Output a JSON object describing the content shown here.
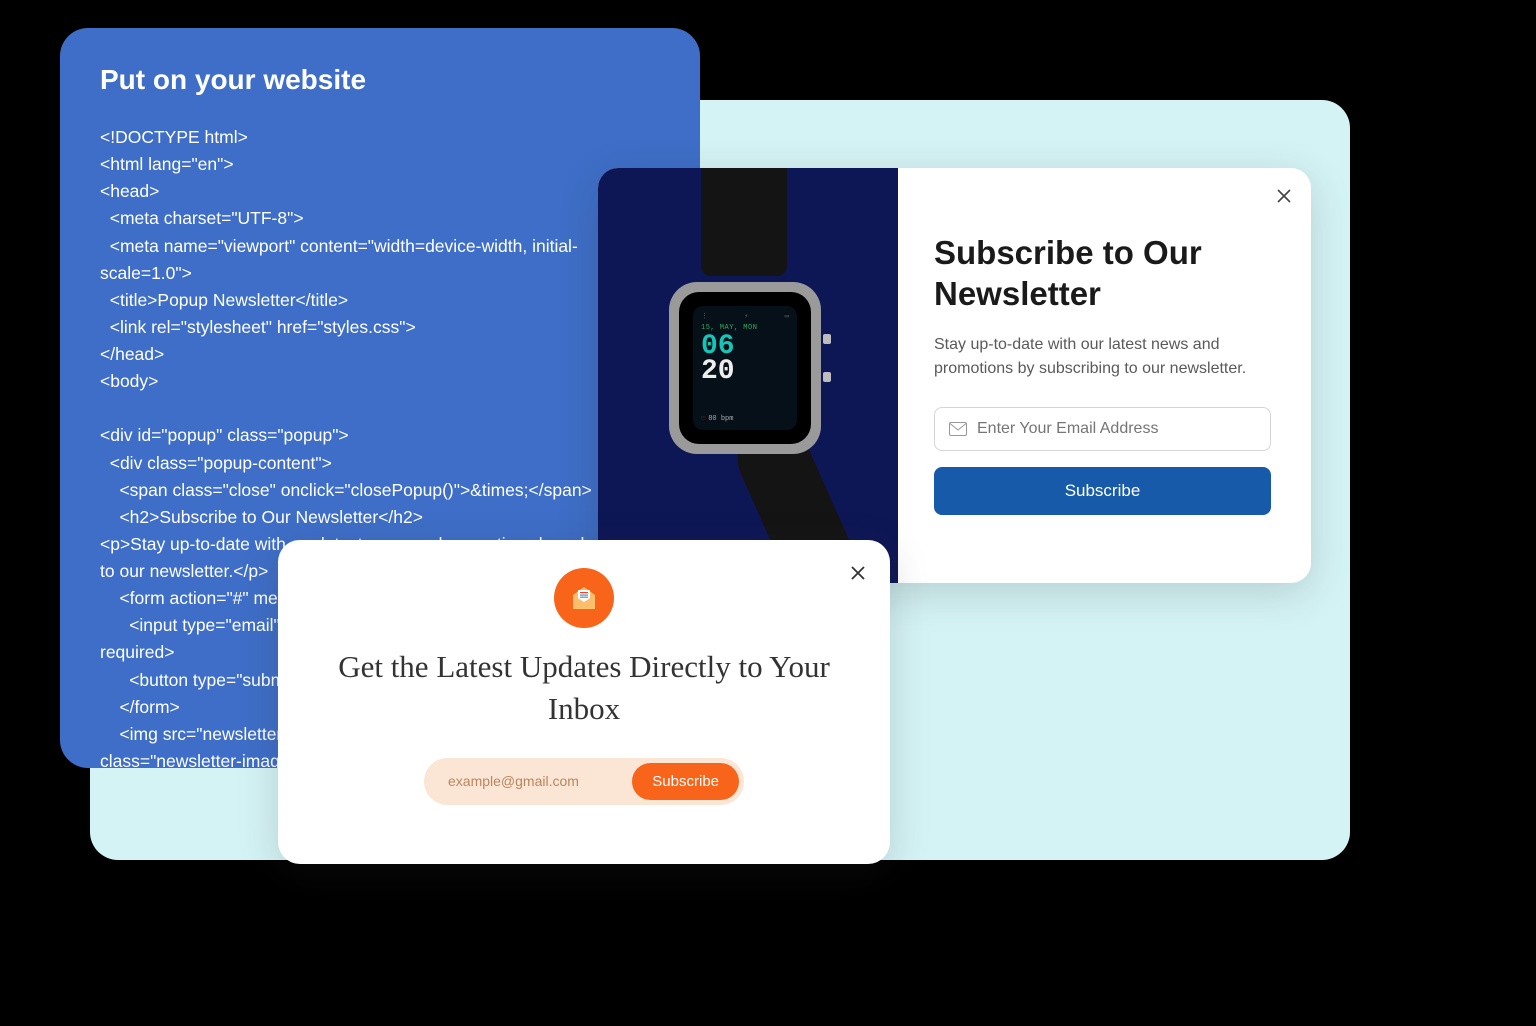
{
  "code_card": {
    "title": "Put on your website",
    "code": "<!DOCTYPE html>\n<html lang=\"en\">\n<head>\n  <meta charset=\"UTF-8\">\n  <meta name=\"viewport\" content=\"width=device-width, initial-scale=1.0\">\n  <title>Popup Newsletter</title>\n  <link rel=\"stylesheet\" href=\"styles.css\">\n</head>\n<body>\n\n<div id=\"popup\" class=\"popup\">\n  <div class=\"popup-content\">\n    <span class=\"close\" onclick=\"closePopup()\">&times;</span>\n    <h2>Subscribe to Our Newsletter</h2>\n<p>Stay up-to-date with our latest news and promotions by subscribing to our newsletter.</p>\n    <form action=\"#\" method=\"post\" id=\"subscribe-form\">\n      <input type=\"email\" name=\"email\" placeholder=\"Enter your email\" required>\n      <button type=\"submit\">Subscribe</button>\n    </form>\n    <img src=\"newsletter-image.jpg\" alt=\"Newsletter Image\" class=\"newsletter-image\">\n  </div>\n</div>\n\n<script src=\"script.js\"></script>\n</body>\n</html>"
  },
  "popup1": {
    "heading": "Subscribe to Our Newsletter",
    "body": "Stay up-to-date with our latest news and promotions by subscribing to our newsletter.",
    "email_placeholder": "Enter Your Email Address",
    "subscribe_label": "Subscribe",
    "watch": {
      "date": "15, MAY, MON",
      "hour": "06",
      "minute": "20",
      "bpm": "80 bpm"
    }
  },
  "popup2": {
    "heading": "Get the Latest Updates Directly to Your Inbox",
    "email_placeholder": "example@gmail.com",
    "subscribe_label": "Subscribe"
  }
}
